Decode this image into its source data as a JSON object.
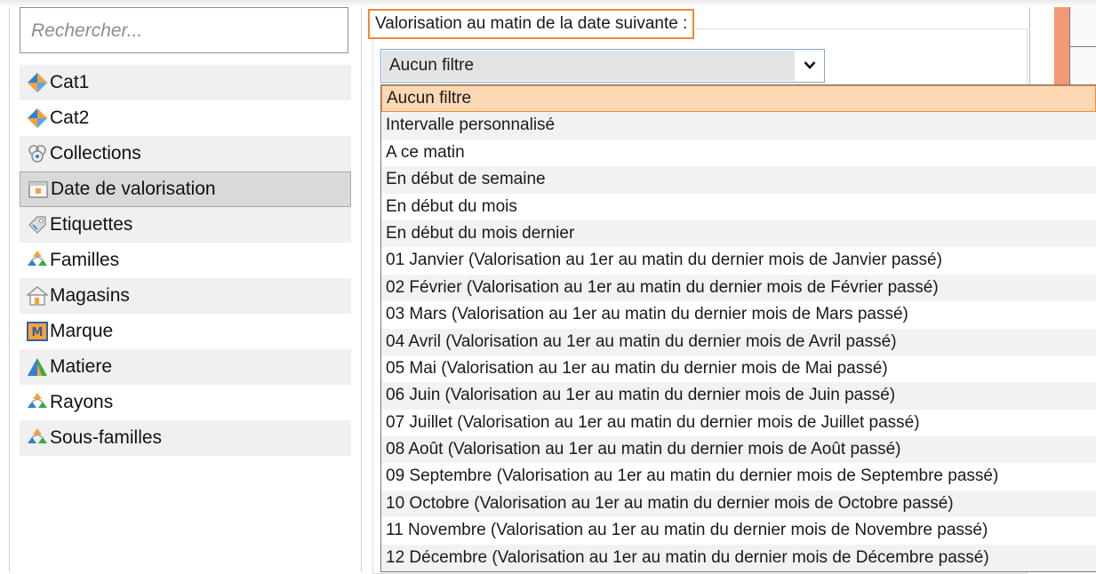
{
  "search": {
    "placeholder": "Rechercher..."
  },
  "categories": [
    {
      "label": "Cat1",
      "icon": "diamond-icon"
    },
    {
      "label": "Cat2",
      "icon": "diamond-icon"
    },
    {
      "label": "Collections",
      "icon": "collections-icon"
    },
    {
      "label": "Date de valorisation",
      "icon": "calendar-icon",
      "selected": true
    },
    {
      "label": "Etiquettes",
      "icon": "tag-icon"
    },
    {
      "label": "Familles",
      "icon": "family-icon"
    },
    {
      "label": "Magasins",
      "icon": "store-icon"
    },
    {
      "label": "Marque",
      "icon": "brand-icon"
    },
    {
      "label": "Matiere",
      "icon": "material-icon"
    },
    {
      "label": "Rayons",
      "icon": "family-icon"
    },
    {
      "label": "Sous-familles",
      "icon": "family-icon"
    }
  ],
  "filter": {
    "label": "Valorisation au matin de la date suivante :",
    "selected": "Aucun filtre",
    "options": [
      "Aucun filtre",
      "Intervalle personnalisé",
      "A ce matin",
      "En début de semaine",
      "En début du mois",
      "En début du mois dernier",
      "01 Janvier (Valorisation au 1er au matin du dernier mois de Janvier passé)",
      "02 Février (Valorisation au 1er au matin du dernier mois de Février passé)",
      "03 Mars (Valorisation au 1er au matin du dernier mois de Mars passé)",
      "04 Avril (Valorisation au 1er au matin du dernier mois de Avril passé)",
      "05 Mai (Valorisation au 1er au matin du dernier mois de Mai passé)",
      "06 Juin (Valorisation au 1er au matin du dernier mois de Juin passé)",
      "07 Juillet (Valorisation au 1er au matin du dernier mois de Juillet passé)",
      "08 Août (Valorisation au 1er au matin du dernier mois de Août passé)",
      "09 Septembre (Valorisation au 1er au matin du dernier mois de Septembre passé)",
      "10 Octobre (Valorisation au 1er au matin du dernier mois de Octobre passé)",
      "11 Novembre (Valorisation au 1er au matin du dernier mois de Novembre passé)",
      "12 Décembre (Valorisation au 1er au matin du dernier mois de Décembre passé)"
    ]
  },
  "colors": {
    "accent": "#f08a35",
    "selection_fill": "#fcd7b4",
    "right_strip": "#f29a76"
  }
}
